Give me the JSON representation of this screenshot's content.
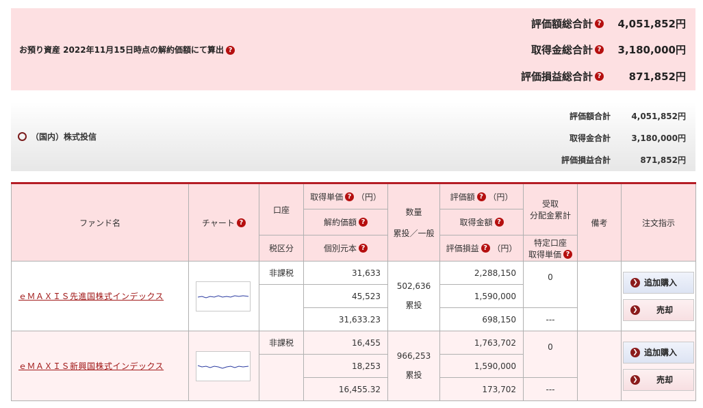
{
  "summary": {
    "asset_label": "お預り資産 2022年11月15日時点の解約価額にて算出",
    "rows": [
      {
        "label": "評価額総合計",
        "value": "4,051,852円"
      },
      {
        "label": "取得金総合計",
        "value": "3,180,000円"
      },
      {
        "label": "評価損益総合計",
        "value": "871,852円"
      }
    ]
  },
  "category": {
    "label": "（国内）株式投信",
    "rows": [
      {
        "label": "評価額合計",
        "value": "4,051,852円"
      },
      {
        "label": "取得金合計",
        "value": "3,180,000円"
      },
      {
        "label": "評価損益合計",
        "value": "871,852円"
      }
    ]
  },
  "table": {
    "headers": {
      "fund_name": "ファンド名",
      "chart": "チャート",
      "account": "口座",
      "tax_class": "税区分",
      "acq_unit_price": "取得単価",
      "acq_unit_price_unit": "（円）",
      "nav": "解約価額",
      "individual_principal": "個別元本",
      "quantity": "数量",
      "cumulative_general": "累投／一般",
      "valuation": "評価額",
      "valuation_unit": "（円）",
      "acq_amount": "取得金額",
      "unrealized_pl": "評価損益",
      "unrealized_pl_unit": "（円）",
      "received_line1": "受取",
      "received_line2": "分配金累計",
      "specific_line1": "特定口座",
      "specific_line2": "取得単価",
      "remarks": "備考",
      "order": "注文指示"
    },
    "rows": [
      {
        "fund_name": "ｅＭＡＸＩＳ先進国株式インデックス",
        "tax_class": "非課税",
        "acq_unit_price": "31,633",
        "nav": "45,523",
        "individual_principal": "31,633.23",
        "quantity": "502,636",
        "cumulative": "累投",
        "valuation": "2,288,150",
        "acq_amount": "1,590,000",
        "unrealized_pl": "698,150",
        "received_dist": "0",
        "specific_acq": "---",
        "buy_label": "追加購入",
        "sell_label": "売却"
      },
      {
        "fund_name": "ｅＭＡＸＩＳ新興国株式インデックス",
        "tax_class": "非課税",
        "acq_unit_price": "16,455",
        "nav": "18,253",
        "individual_principal": "16,455.32",
        "quantity": "966,253",
        "cumulative": "累投",
        "valuation": "1,763,702",
        "acq_amount": "1,590,000",
        "unrealized_pl": "173,702",
        "received_dist": "0",
        "specific_acq": "---",
        "buy_label": "追加購入",
        "sell_label": "売却"
      }
    ]
  },
  "icons": {
    "help": "question-mark-icon",
    "category": "circle-icon",
    "button_arrow": "chevron-right-icon"
  },
  "colors": {
    "accent": "#b51c25",
    "summary_bg": "#fde0e2",
    "help_icon": "#b50f0f"
  }
}
